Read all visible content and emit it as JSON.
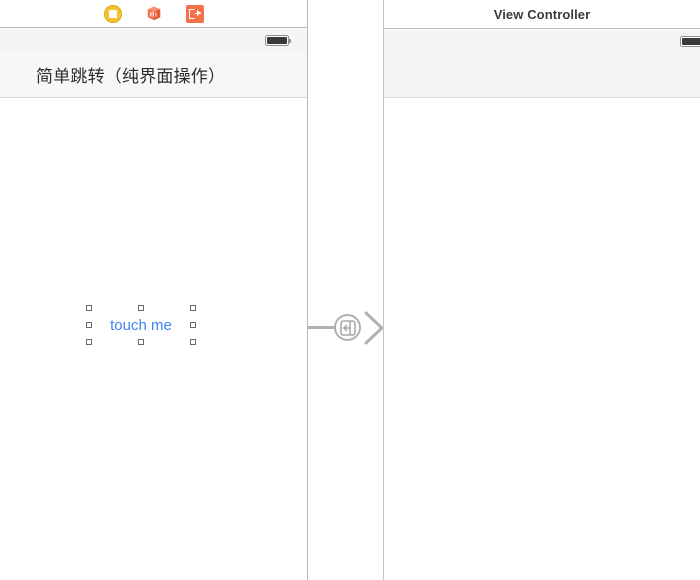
{
  "canvas": {
    "background": "#ffffff"
  },
  "left_scene": {
    "dock": {
      "icons": [
        {
          "name": "view-controller-icon",
          "label": "View Controller",
          "color": "#f2c230"
        },
        {
          "name": "first-responder-icon",
          "label": "First Responder",
          "color": "#f4714a"
        },
        {
          "name": "exit-icon",
          "label": "Exit",
          "color": "#f4714a"
        }
      ]
    },
    "status_bar": {
      "battery_label": "battery-icon"
    },
    "nav_bar": {
      "title": "简单跳转（纯界面操作）"
    },
    "button": {
      "label": "touch me",
      "color": "#3f84f2",
      "selected": true,
      "handles": 8
    }
  },
  "segue": {
    "name": "show-segue",
    "glyph": "show-segue-icon",
    "color": "#b0b0b0"
  },
  "right_scene": {
    "title": "View Controller",
    "status_bar": {
      "battery_label": "battery-icon"
    }
  }
}
